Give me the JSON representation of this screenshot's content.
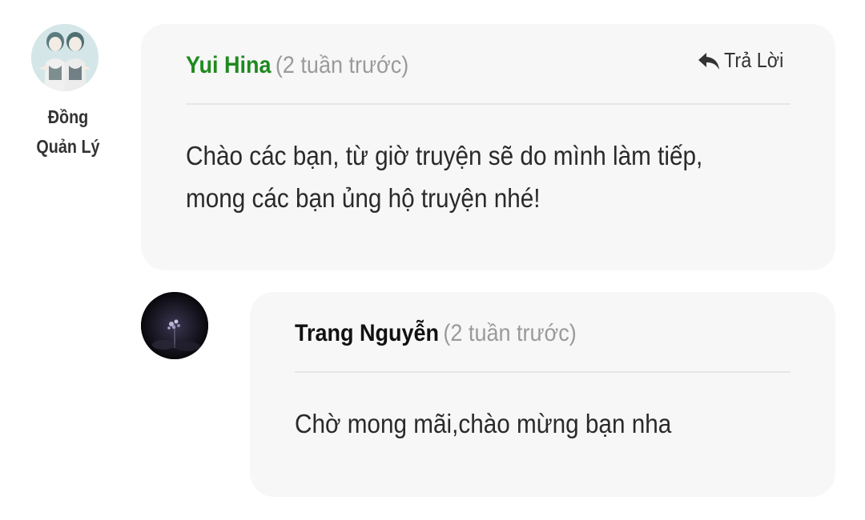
{
  "comments": [
    {
      "author": "Yui Hina",
      "time": "(2 tuần trước)",
      "role": [
        "Đồng",
        "Quản Lý"
      ],
      "reply_label": "Trả Lời",
      "body": [
        "Chào các bạn, từ giờ truyện sẽ do mình làm tiếp,",
        "mong các bạn ủng hộ truyện nhé!"
      ],
      "name_color": "#1f8a1f"
    }
  ],
  "replies": [
    {
      "author": "Trang Nguyễn",
      "time": "(2 tuần trước)",
      "body": "Chờ mong mãi,chào mừng bạn nha",
      "name_color": "#111111"
    }
  ],
  "icons": {
    "reply": "reply-arrow-icon"
  }
}
